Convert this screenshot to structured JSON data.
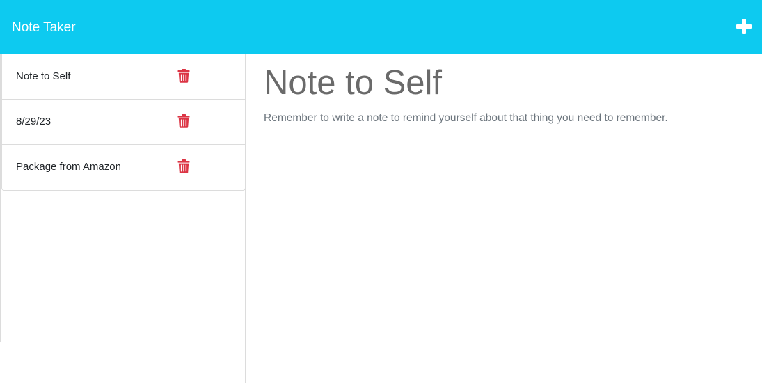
{
  "app": {
    "brand": "Note Taker",
    "new_note_icon": "plus-icon"
  },
  "colors": {
    "navbar": "#0dcaf0",
    "delete_icon": "#dc3545",
    "note_text": "#6c757d"
  },
  "notes": [
    {
      "title": "Note to Self",
      "icon": "trash-icon"
    },
    {
      "title": "8/29/23",
      "icon": "trash-icon"
    },
    {
      "title": "Package from Amazon",
      "icon": "trash-icon"
    }
  ],
  "active_note": {
    "title": "Note to Self",
    "text": "Remember to write a note to remind yourself about that thing you need to remember."
  }
}
